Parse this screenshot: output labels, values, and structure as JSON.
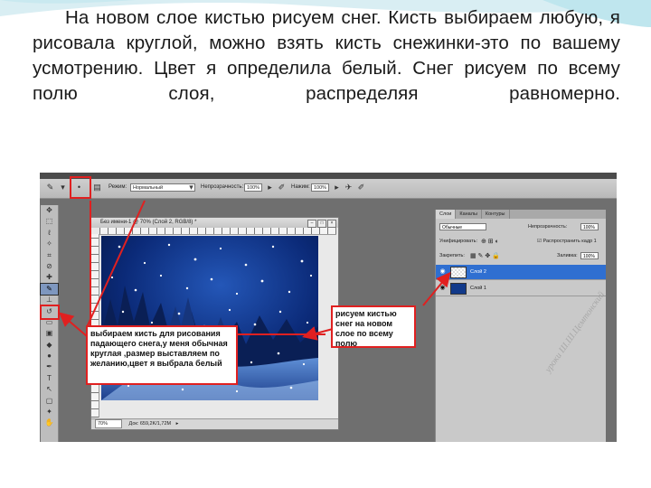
{
  "lesson": {
    "paragraph": "На новом слое кистью рисуем снег. Кисть выбираем любую, я рисовала круглой, можно взять кисть снежинки-это по вашему усмотрению. Цвет я определила белый. Снег рисуем по всему полю слоя, распределяя равномерно."
  },
  "options_bar": {
    "mode_label": "Режим:",
    "mode_value": "Нормальный",
    "opacity_label": "Непрозрачность:",
    "opacity_value": "100%",
    "press_label": "Нажим:",
    "press_value": "100%"
  },
  "document": {
    "title": "Без имени-1 @ 70% (Слой 2, RGB/8) *",
    "zoom": "70%",
    "doc_size": "Док: 659,2K/1,72M"
  },
  "layers_panel": {
    "tabs": [
      "Слои",
      "Каналы",
      "Контуры"
    ],
    "blend_mode": "Обычные",
    "opacity_label": "Непрозрачность:",
    "opacity_value": "100%",
    "unify_label": "Унифицировать:",
    "propagate_label": "Распространить кадр 1",
    "lock_label": "Закрепить:",
    "fill_label": "Заливка:",
    "fill_value": "100%",
    "layers": [
      {
        "name": "Слой 2",
        "selected": true
      },
      {
        "name": "Слой 1",
        "selected": false
      }
    ]
  },
  "callouts": {
    "brush_note": "выбираем кисть для рисования падающего снега,у меня обычная круглая ,размер выставляем по желанию,цвет я выбрала белый",
    "layer_note": "рисуем кистью снег на новом слое по всему полю"
  },
  "watermark": "уроки Ш.Ш.Цемтонский",
  "colors": {
    "accent_red": "#e02020",
    "selected_layer": "#2f6fd1",
    "snow_sky": "#0b2a78"
  }
}
